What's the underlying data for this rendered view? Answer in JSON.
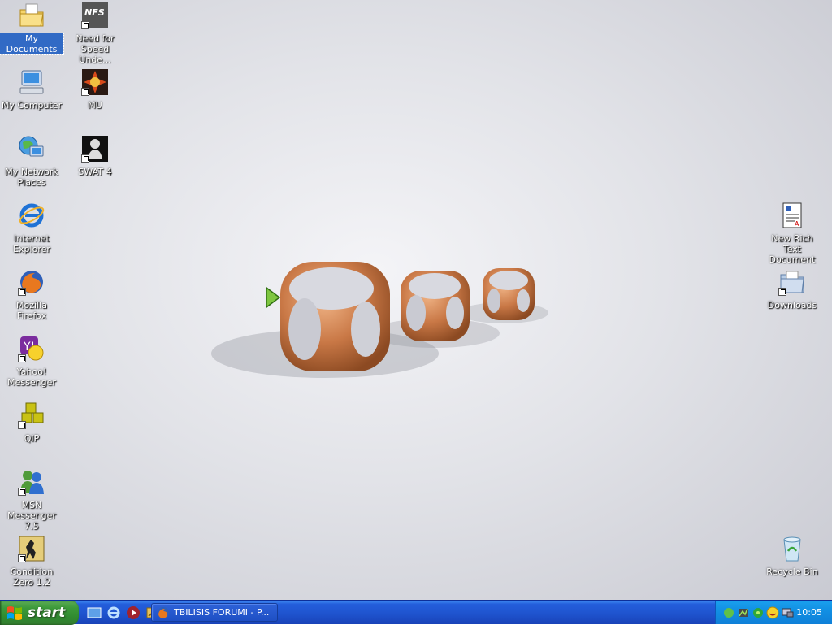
{
  "desktop": {
    "icons_left_col1": [
      {
        "name": "my-documents",
        "label": "My Documents",
        "shortcut": false,
        "selected": true
      },
      {
        "name": "my-computer",
        "label": "My Computer",
        "shortcut": false
      },
      {
        "name": "my-network-places",
        "label": "My Network Places",
        "shortcut": false
      },
      {
        "name": "internet-explorer",
        "label": "Internet Explorer",
        "shortcut": false
      },
      {
        "name": "mozilla-firefox",
        "label": "Mozilla Firefox",
        "shortcut": true
      },
      {
        "name": "yahoo-messenger",
        "label": "Yahoo! Messenger",
        "shortcut": true
      },
      {
        "name": "qip",
        "label": "QIP",
        "shortcut": true
      },
      {
        "name": "msn-messenger",
        "label": "MSN Messenger 7.5",
        "shortcut": true
      },
      {
        "name": "condition-zero",
        "label": "Condition Zero 1.2",
        "shortcut": true
      }
    ],
    "icons_left_col2": [
      {
        "name": "need-for-speed",
        "label": "Need for Speed Unde...",
        "shortcut": true
      },
      {
        "name": "mu",
        "label": "MU",
        "shortcut": true
      },
      {
        "name": "swat-4",
        "label": "SWAT 4",
        "shortcut": true
      }
    ],
    "icons_right": [
      {
        "name": "new-rich-text-document",
        "label": "New Rich Text Document"
      },
      {
        "name": "downloads",
        "label": "Downloads"
      },
      {
        "name": "recycle-bin",
        "label": "Recycle Bin"
      }
    ]
  },
  "taskbar": {
    "start_label": "start",
    "quicklaunch": [
      "show-desktop-icon",
      "internet-explorer-icon",
      "media-player-icon",
      "quick-app-icon"
    ],
    "tasks": [
      {
        "label": "TBILISIS FORUMI - P...",
        "icon": "firefox-icon"
      }
    ],
    "tray_icons": [
      "messenger-tray-icon",
      "network-tray-icon",
      "qip-tray-icon",
      "yahoo-tray-icon",
      "display-tray-icon"
    ],
    "clock": "10:05"
  },
  "colors": {
    "taskbar_blue": "#245edb",
    "start_green": "#3c9a3a",
    "tray_blue": "#1290e4",
    "selection": "#316ac5"
  }
}
